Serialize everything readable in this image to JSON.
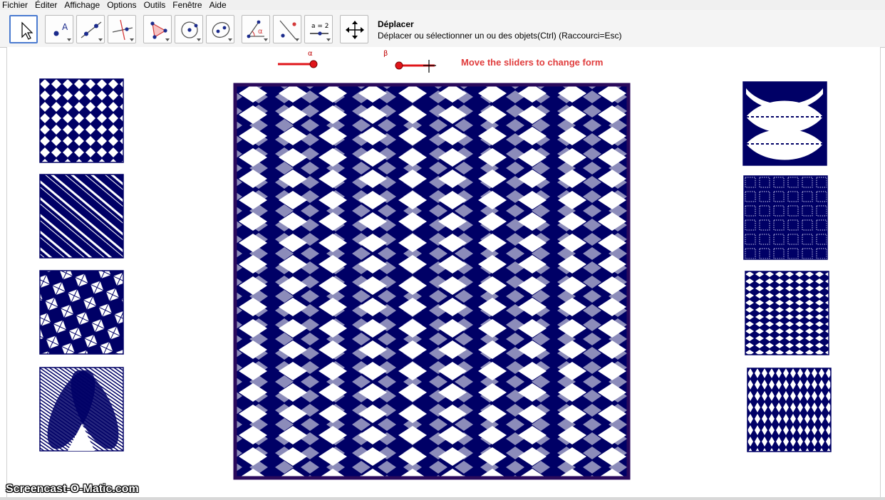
{
  "menu": [
    "Fichier",
    "Éditer",
    "Affichage",
    "Options",
    "Outils",
    "Fenêtre",
    "Aide"
  ],
  "toolbar": {
    "tools": [
      {
        "name": "move-tool",
        "icon": "arrow-cursor-icon",
        "selected": true
      },
      {
        "name": "point-tool",
        "icon": "point-icon",
        "label": "A"
      },
      {
        "name": "line-tool",
        "icon": "line-through-points-icon"
      },
      {
        "name": "perpendicular-tool",
        "icon": "perpendicular-line-icon"
      },
      {
        "name": "polygon-tool",
        "icon": "polygon-icon"
      },
      {
        "name": "circle-tool",
        "icon": "circle-center-point-icon"
      },
      {
        "name": "ellipse-tool",
        "icon": "ellipse-icon"
      },
      {
        "name": "angle-tool",
        "icon": "angle-icon",
        "label": "α"
      },
      {
        "name": "reflect-tool",
        "icon": "reflect-icon"
      },
      {
        "name": "slider-tool",
        "icon": "slider-icon",
        "label": "a = 2"
      },
      {
        "name": "move-view-tool",
        "icon": "move-graphics-view-icon"
      }
    ],
    "help_title": "Déplacer",
    "help_text": "Déplacer ou sélectionner un ou des objets(Ctrl) (Raccourci=Esc)"
  },
  "sliders": [
    {
      "name": "alpha",
      "label": "α",
      "position": 1.0
    },
    {
      "name": "beta",
      "label": "β",
      "position": 0.0
    }
  ],
  "instruction": "Move the sliders to change form",
  "colors": {
    "pattern": "#000066",
    "frame": "#2a0a5c",
    "slider_red": "#e0151a",
    "instruction": "#e03c3c",
    "tool_selected_border": "#4b7bd0"
  },
  "thumbnails": {
    "left_count": 4,
    "right_count": 4
  },
  "watermark": "Screencast-O-Matic.com"
}
